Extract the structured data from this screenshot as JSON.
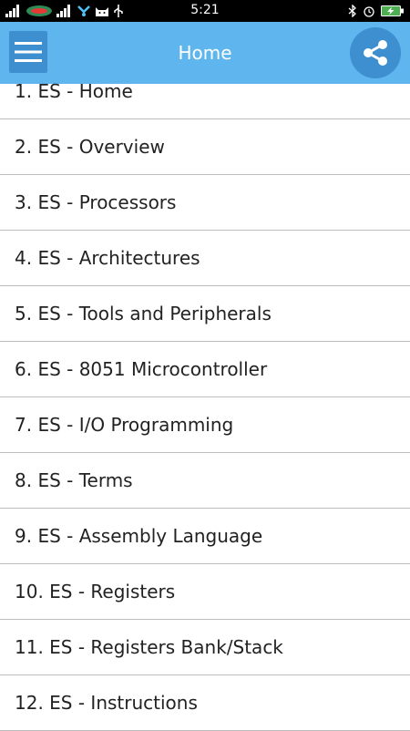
{
  "status_bar": {
    "time": "5:21",
    "left_icons": [
      "signal-icon",
      "carrier-logo-icon",
      "signal-icon",
      "wifi-icon",
      "cat-icon",
      "usb-icon"
    ],
    "right_icons": [
      "bluetooth-icon",
      "alarm-icon",
      "battery-charging-icon"
    ]
  },
  "app_bar": {
    "title": "Home",
    "menu_icon": "hamburger-menu-icon",
    "share_icon": "share-icon",
    "color": "#5fb6ee",
    "accent_dark": "#3d8fcf"
  },
  "list": {
    "items": [
      {
        "label": "1. ES - Home"
      },
      {
        "label": "2. ES - Overview"
      },
      {
        "label": "3. ES - Processors"
      },
      {
        "label": "4. ES - Architectures"
      },
      {
        "label": "5. ES - Tools and Peripherals"
      },
      {
        "label": "6. ES - 8051 Microcontroller"
      },
      {
        "label": "7. ES - I/O Programming"
      },
      {
        "label": "8. ES - Terms"
      },
      {
        "label": "9. ES - Assembly Language"
      },
      {
        "label": "10. ES - Registers"
      },
      {
        "label": "11. ES - Registers Bank/Stack"
      },
      {
        "label": "12. ES - Instructions"
      }
    ]
  }
}
